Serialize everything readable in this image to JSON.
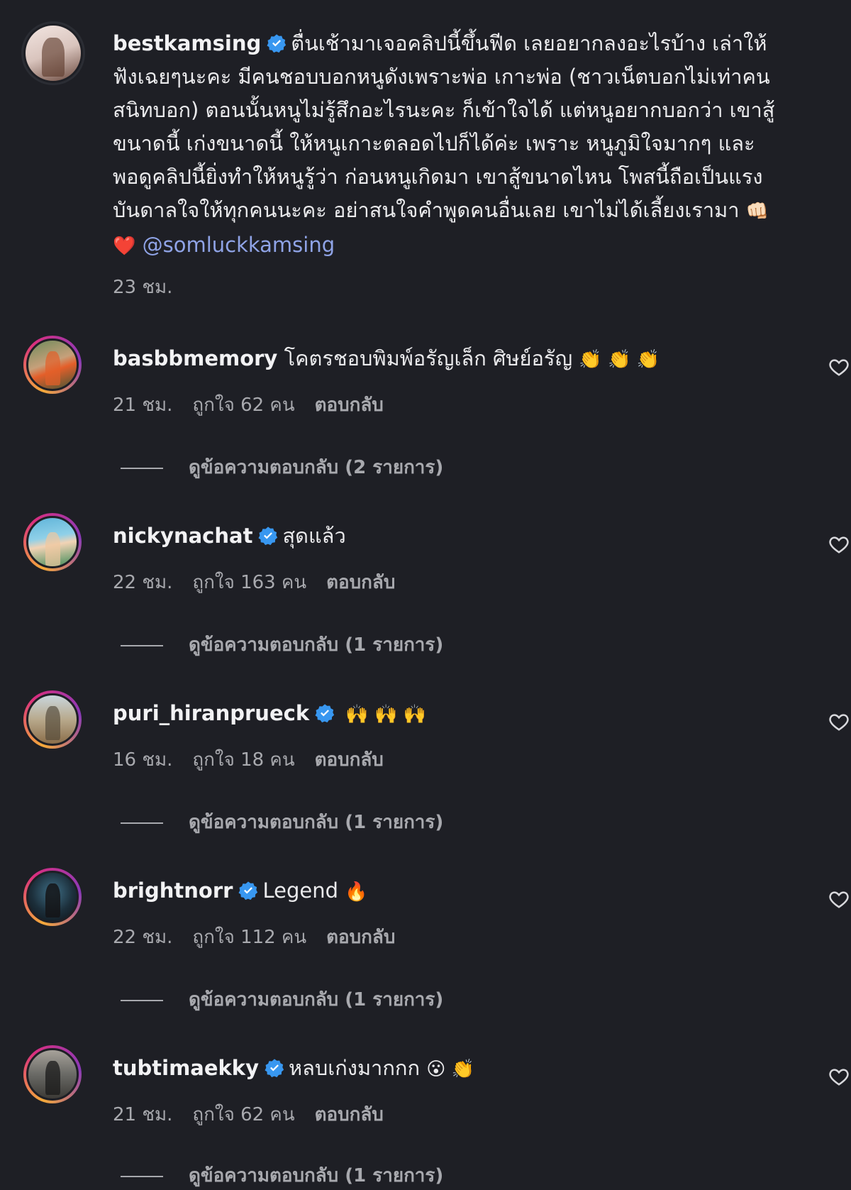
{
  "post": {
    "username": "bestkamsing",
    "caption": "ตื่นเช้ามาเจอคลิปนี้ขึ้นฟีด เลยอยากลงอะไรบ้าง เล่าให้ฟังเฉยๆนะคะ มีคนชอบบอกหนูดังเพราะพ่อ เกาะพ่อ (ชาวเน็ตบอกไม่เท่าคนสนิทบอก) ตอนนั้นหนูไม่รู้สึกอะไรนะคะ ก็เข้าใจได้ แต่หนูอยากบอกว่า เขาสู้ขนาดนี้ เก่งขนาดนี้ ให้หนูเกาะตลอดไปก็ได้ค่ะ เพราะ หนูภูมิใจมากๆ และพอดูคลิปนี้ยิ่งทำให้หนูรู้ว่า ก่อนหนูเกิดมา เขาสู้ขนาดไหน โพสนี้ถือเป็นแรงบันดาลใจให้ทุกคนนะคะ อย่าสนใจคำพูดคนอื่นเลย เขาไม่ได้เลี้ยงเรามา",
    "caption_emoji": "👊🏻 ❤️",
    "mention": "@somluckkamsing",
    "time": "23 ชม."
  },
  "comments": [
    {
      "username": "basbbmemory",
      "verified": false,
      "text": "โคตรชอบพิมพ์อรัญเล็ก ศิษย์อรัญ",
      "emoji": "👏 👏 👏",
      "time": "21 ชม.",
      "likes": "ถูกใจ 62 คน",
      "reply": "ตอบกลับ",
      "view_replies": "ดูข้อความตอบกลับ (2 รายการ)"
    },
    {
      "username": "nickynachat",
      "verified": true,
      "text": "สุดแล้ว",
      "emoji": "",
      "time": "22 ชม.",
      "likes": "ถูกใจ 163 คน",
      "reply": "ตอบกลับ",
      "view_replies": "ดูข้อความตอบกลับ (1 รายการ)"
    },
    {
      "username": "puri_hiranprueck",
      "verified": true,
      "text": "",
      "emoji": "🙌 🙌 🙌",
      "time": "16 ชม.",
      "likes": "ถูกใจ 18 คน",
      "reply": "ตอบกลับ",
      "view_replies": "ดูข้อความตอบกลับ (1 รายการ)"
    },
    {
      "username": "brightnorr",
      "verified": true,
      "text": "Legend",
      "emoji": "🔥",
      "time": "22 ชม.",
      "likes": "ถูกใจ 112 คน",
      "reply": "ตอบกลับ",
      "view_replies": "ดูข้อความตอบกลับ (1 รายการ)"
    },
    {
      "username": "tubtimaekky",
      "verified": true,
      "text": "หลบเก่งมากกก",
      "emoji": "😮 👏",
      "time": "21 ชม.",
      "likes": "ถูกใจ 62 คน",
      "reply": "ตอบกลับ",
      "view_replies": "ดูข้อความตอบกลับ (1 รายการ)"
    }
  ],
  "colors": {
    "background": "#1e1f25",
    "verified_badge": "#3897f0",
    "mention": "#8fa3e6",
    "ring_gradient": [
      "#f4a93a",
      "#d92e7f",
      "#8a3ab9"
    ]
  },
  "icons": {
    "verified": "verified-badge-icon",
    "like": "heart-icon"
  }
}
